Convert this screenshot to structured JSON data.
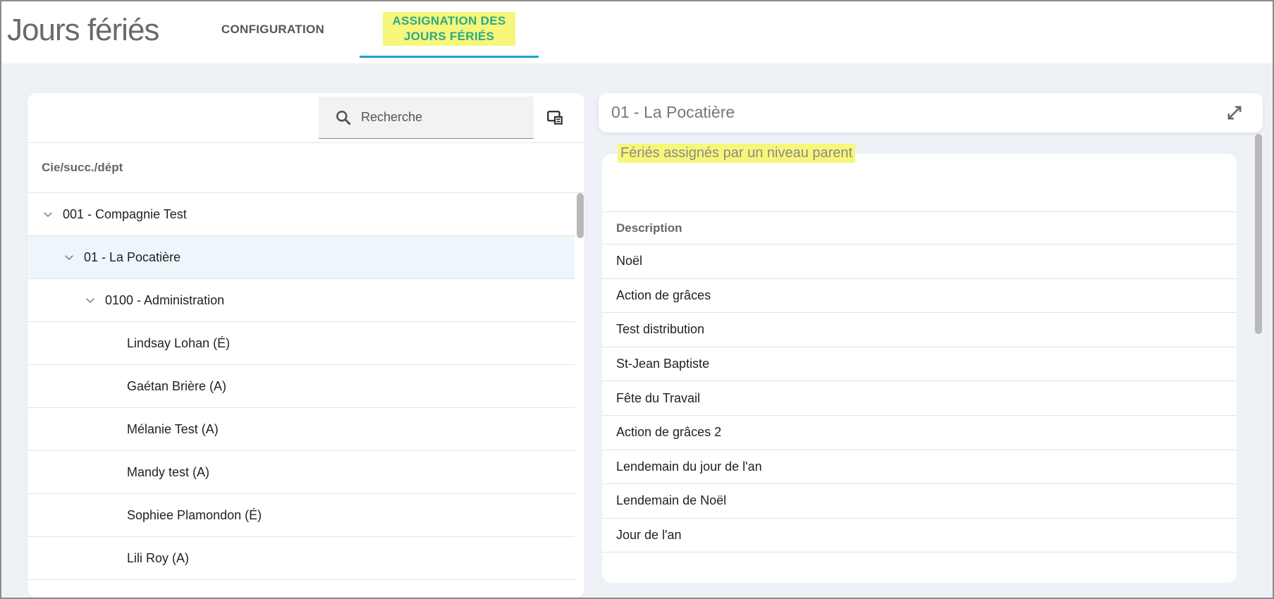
{
  "header": {
    "title": "Jours fériés",
    "tabs": [
      {
        "label": "CONFIGURATION"
      },
      {
        "label": "ASSIGNATION DES\nJOURS FÉRIÉS"
      }
    ]
  },
  "left": {
    "search_placeholder": "Recherche",
    "column_header": "Cie/succ./dépt",
    "tree": [
      {
        "label": "001 - Compagnie Test"
      },
      {
        "label": "01 - La Pocatière"
      },
      {
        "label": "0100 - Administration"
      },
      {
        "label": "Lindsay Lohan (É)"
      },
      {
        "label": "Gaétan Brière (A)"
      },
      {
        "label": "Mélanie Test (A)"
      },
      {
        "label": "Mandy test (A)"
      },
      {
        "label": "Sophiee Plamondon (É)"
      },
      {
        "label": "Lili Roy (A)"
      }
    ]
  },
  "right": {
    "title": "01 - La Pocatière",
    "section_label": "Fériés assignés par un niveau parent",
    "column_header": "Description",
    "rows": [
      "Noël",
      "Action de grâces",
      "Test distribution",
      "St-Jean Baptiste",
      "Fête du Travail",
      "Action de grâces 2",
      "Lendemain du jour de l'an",
      "Lendemain de Noël",
      "Jour de l'an"
    ]
  },
  "colors": {
    "accent": "#1aa0d0",
    "highlight": "#f6f77a",
    "active_tab_text": "#2ea887"
  }
}
